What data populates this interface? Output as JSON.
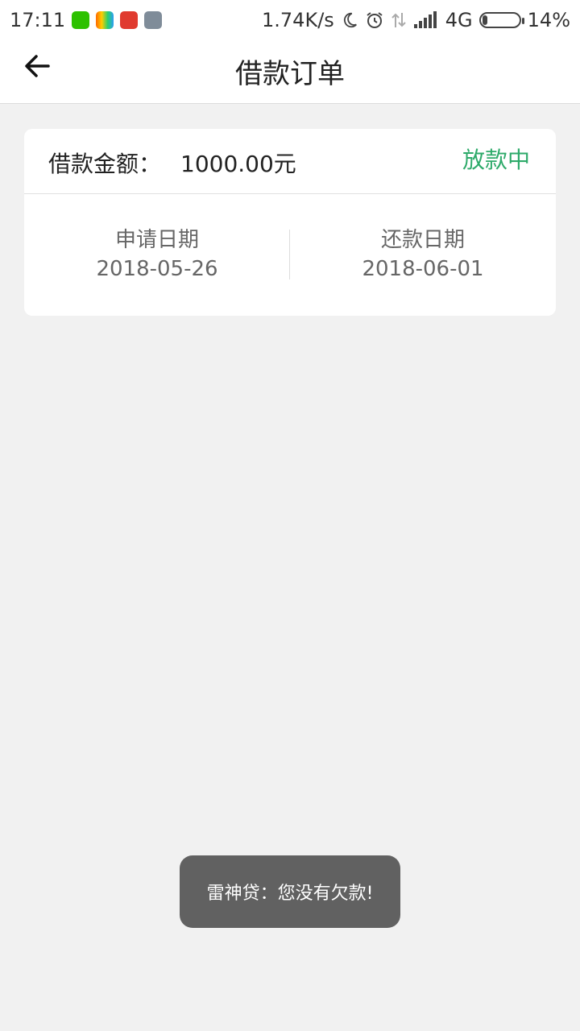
{
  "status_bar": {
    "time": "17:11",
    "net_speed": "1.74K/s",
    "network": "4G",
    "battery": "14%",
    "battery_level": 0.14,
    "icons": [
      "wechat-icon",
      "app-icon-smile",
      "app-icon-red",
      "app-icon-notes",
      "moon-icon",
      "alarm-icon",
      "data-arrows-icon",
      "signal-icon",
      "battery-icon"
    ]
  },
  "header": {
    "title": "借款订单"
  },
  "order": {
    "amount_label": "借款金额：",
    "amount_value": "1000.00元",
    "status": "放款中",
    "apply_date_label": "申请日期",
    "apply_date": "2018-05-26",
    "repay_date_label": "还款日期",
    "repay_date": "2018-06-01"
  },
  "toast": {
    "text": "雷神贷：您没有欠款!"
  },
  "colors": {
    "status_green": "#2eaa6a",
    "background": "#f1f1f1",
    "toast_bg": "#616161"
  }
}
